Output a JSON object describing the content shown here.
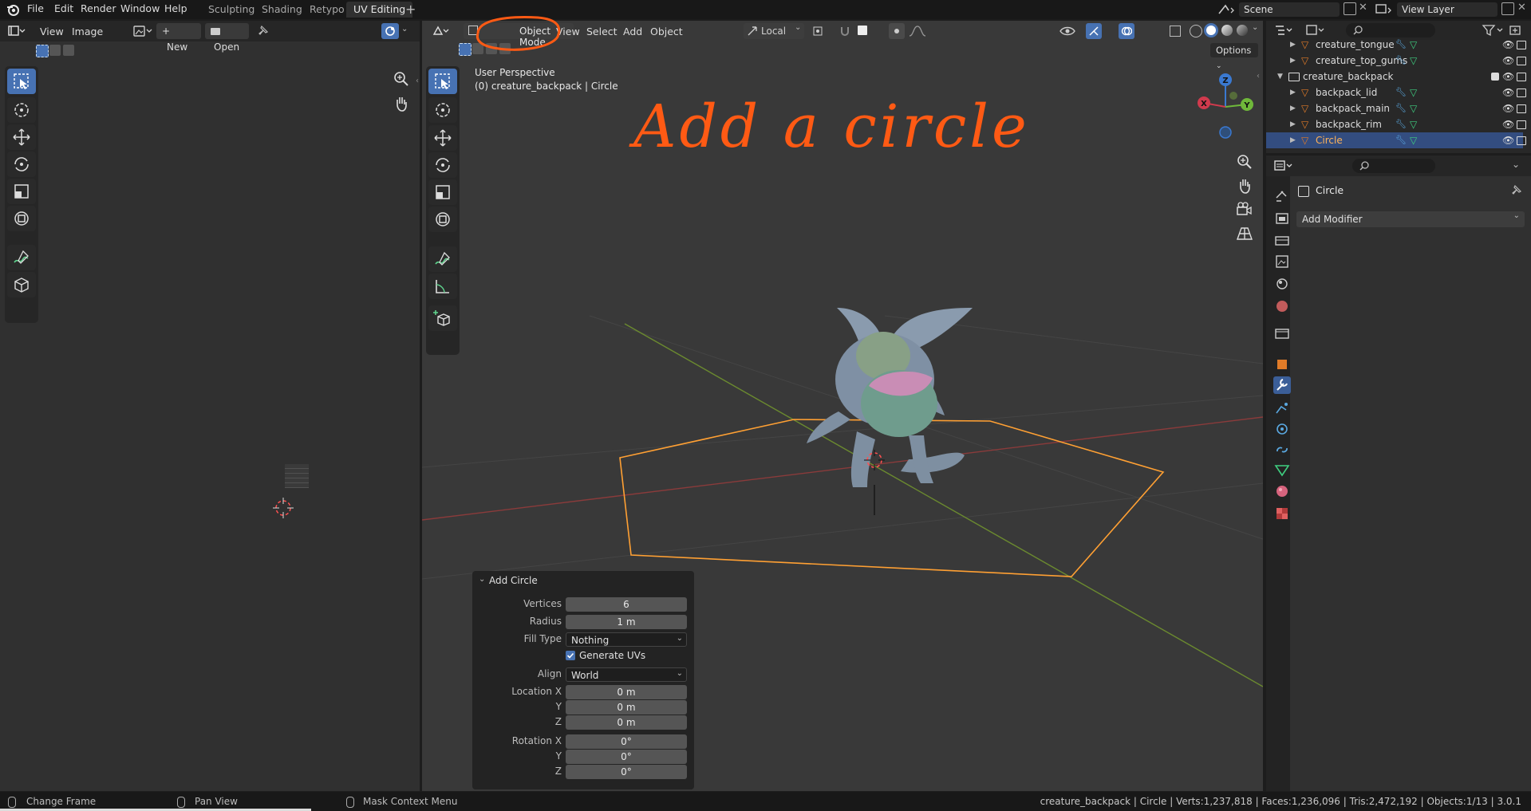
{
  "topbar": {
    "menus": [
      "File",
      "Edit",
      "Render",
      "Window",
      "Help"
    ],
    "workspaces": [
      "Sculpting",
      "Shading",
      "Retypo",
      "UV Editing"
    ],
    "active_workspace": "UV Editing",
    "scene_label": "Scene",
    "view_layer_label": "View Layer"
  },
  "uv_editor": {
    "menus": [
      "View",
      "Image"
    ],
    "new_label": "New",
    "open_label": "Open"
  },
  "viewport": {
    "mode_label": "Object Mode",
    "menus": [
      "View",
      "Select",
      "Add",
      "Object"
    ],
    "transform_orientation": "Local",
    "options_label": "Options",
    "view_name": "User Perspective",
    "context_info": "(0) creature_backpack | Circle",
    "annotation": "Add a circle",
    "gizmo_axes": [
      "X",
      "Y",
      "Z"
    ]
  },
  "outliner": {
    "rows": [
      {
        "label": "creature_tongue",
        "indent": 2,
        "selected": false,
        "kind": "mesh"
      },
      {
        "label": "creature_top_gums",
        "indent": 2,
        "selected": false,
        "kind": "mesh"
      },
      {
        "label": "creature_backpack",
        "indent": 1,
        "selected": false,
        "kind": "collection"
      },
      {
        "label": "backpack_lid",
        "indent": 2,
        "selected": false,
        "kind": "mesh"
      },
      {
        "label": "backpack_main",
        "indent": 2,
        "selected": false,
        "kind": "mesh"
      },
      {
        "label": "backpack_rim",
        "indent": 2,
        "selected": false,
        "kind": "mesh"
      },
      {
        "label": "Circle",
        "indent": 2,
        "selected": true,
        "kind": "mesh"
      }
    ]
  },
  "properties": {
    "object_name": "Circle",
    "add_modifier_label": "Add Modifier"
  },
  "operator_panel": {
    "title": "Add Circle",
    "vertices_label": "Vertices",
    "vertices_value": "6",
    "radius_label": "Radius",
    "radius_value": "1 m",
    "fill_type_label": "Fill Type",
    "fill_type_value": "Nothing",
    "generate_uvs_label": "Generate UVs",
    "generate_uvs_checked": true,
    "align_label": "Align",
    "align_value": "World",
    "location_x_label": "Location X",
    "location_x_value": "0 m",
    "location_y_label": "Y",
    "location_y_value": "0 m",
    "location_z_label": "Z",
    "location_z_value": "0 m",
    "rotation_x_label": "Rotation X",
    "rotation_x_value": "0°",
    "rotation_y_label": "Y",
    "rotation_y_value": "0°",
    "rotation_z_label": "Z",
    "rotation_z_value": "0°"
  },
  "status_bar": {
    "hint_left": "Change Frame",
    "hint_middle": "Pan View",
    "hint_right": "Mask Context Menu",
    "stats": "creature_backpack | Circle | Verts:1,237,818 | Faces:1,236,096 | Tris:2,472,192 | Objects:1/13 | 3.0.1"
  },
  "colors": {
    "accent_blue": "#4772b3",
    "selection_orange": "#ffa033",
    "annotation_orange": "#ff5a14"
  }
}
